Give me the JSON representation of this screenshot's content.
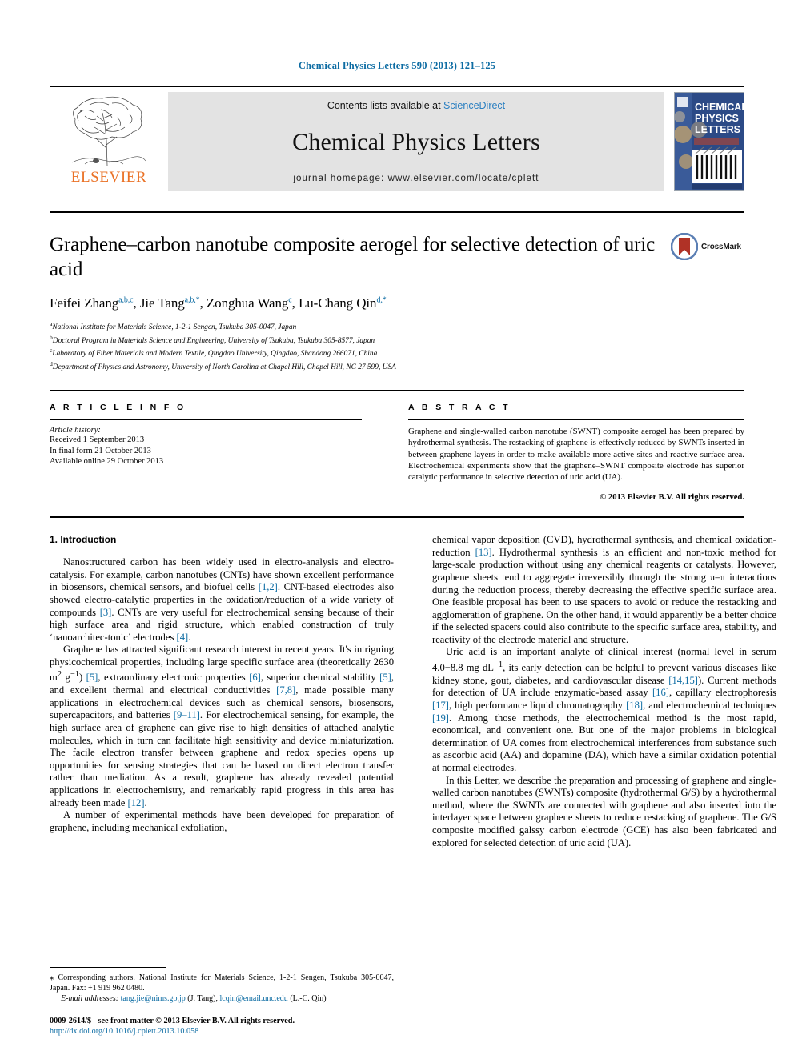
{
  "running_head": "Chemical Physics Letters 590 (2013) 121–125",
  "masthead": {
    "publisher_name": "ELSEVIER",
    "contents_prefix": "Contents lists available at ",
    "contents_link": "ScienceDirect",
    "journal_title": "Chemical Physics Letters",
    "homepage_line": "journal homepage: www.elsevier.com/locate/cplett",
    "cover": {
      "line1": "CHEMICAL",
      "line2": "PHYSICS",
      "line3": "LETTERS",
      "background": "#2c4a86",
      "title_color": "#ffffff"
    }
  },
  "article": {
    "title": "Graphene–carbon nanotube composite aerogel for selective detection of uric acid",
    "authors": [
      {
        "name": "Feifei Zhang",
        "sup": "a,b,c",
        "sep": ", "
      },
      {
        "name": "Jie Tang",
        "sup": "a,b,*",
        "sep": ", "
      },
      {
        "name": "Zonghua Wang",
        "sup": "c",
        "sep": ", "
      },
      {
        "name": "Lu-Chang Qin",
        "sup": "d,*",
        "sep": ""
      }
    ],
    "affiliations": [
      {
        "mark": "a",
        "text": "National Institute for Materials Science, 1-2-1 Sengen, Tsukuba 305-0047, Japan"
      },
      {
        "mark": "b",
        "text": "Doctoral Program in Materials Science and Engineering, University of Tsukuba, Tsukuba 305-8577, Japan"
      },
      {
        "mark": "c",
        "text": "Laboratory of Fiber Materials and Modern Textile, Qingdao University, Qingdao, Shandong 266071, China"
      },
      {
        "mark": "d",
        "text": "Department of Physics and Astronomy, University of North Carolina at Chapel Hill, Chapel Hill, NC 27 599, USA"
      }
    ],
    "crossmark_label": "CrossMark"
  },
  "info": {
    "heading": "A R T I C L E    I N F O",
    "history_label": "Article history:",
    "history": [
      "Received 1 September 2013",
      "In final form 21 October 2013",
      "Available online 29 October 2013"
    ]
  },
  "abstract": {
    "heading": "A B S T R A C T",
    "text": "Graphene and single-walled carbon nanotube (SWNT) composite aerogel has been prepared by hydrothermal synthesis. The restacking of graphene is effectively reduced by SWNTs inserted in between graphene layers in order to make available more active sites and reactive surface area. Electrochemical experiments show that the graphene–SWNT composite electrode has superior catalytic performance in selective detection of uric acid (UA).",
    "copyright": "© 2013 Elsevier B.V. All rights reserved."
  },
  "body": {
    "section_title": "1. Introduction",
    "left_paragraphs": [
      {
        "parts": [
          {
            "t": "Nanostructured carbon has been widely used in electro-analysis and electro-catalysis. For example, carbon nanotubes (CNTs) have shown excellent performance in biosensors, chemical sensors, and biofuel cells "
          },
          {
            "t": "[1,2]",
            "ref": true
          },
          {
            "t": ". CNT-based electrodes also showed electro-catalytic properties in the oxidation/reduction of a wide variety of compounds "
          },
          {
            "t": "[3]",
            "ref": true
          },
          {
            "t": ". CNTs are very useful for electrochemical sensing because of their high surface area and rigid structure, which enabled construction of truly ‘nanoarchitec-tonic’ electrodes "
          },
          {
            "t": "[4]",
            "ref": true
          },
          {
            "t": "."
          }
        ]
      },
      {
        "parts": [
          {
            "t": "Graphene has attracted significant research interest in recent years. It's intriguing physicochemical properties, including large specific surface area (theoretically 2630 m"
          },
          {
            "t": "2",
            "sup": true
          },
          {
            "t": " g"
          },
          {
            "t": "−1",
            "sup": true
          },
          {
            "t": ") "
          },
          {
            "t": "[5]",
            "ref": true
          },
          {
            "t": ", extraordinary electronic properties "
          },
          {
            "t": "[6]",
            "ref": true
          },
          {
            "t": ", superior chemical stability "
          },
          {
            "t": "[5]",
            "ref": true
          },
          {
            "t": ", and excellent thermal and electrical conductivities "
          },
          {
            "t": "[7,8]",
            "ref": true
          },
          {
            "t": ", made possible many applications in electrochemical devices such as chemical sensors, biosensors, supercapacitors, and batteries "
          },
          {
            "t": "[9–11]",
            "ref": true
          },
          {
            "t": ". For electrochemical sensing, for example, the high surface area of graphene can give rise to high densities of attached analytic molecules, which in turn can facilitate high sensitivity and device miniaturization. The facile electron transfer between graphene and redox species opens up opportunities for sensing strategies that can be based on direct electron transfer rather than mediation. As a result, graphene has already revealed potential applications in electrochemistry, and remarkably rapid progress in this area has already been made "
          },
          {
            "t": "[12]",
            "ref": true
          },
          {
            "t": "."
          }
        ]
      },
      {
        "parts": [
          {
            "t": "A number of experimental methods have been developed for preparation of graphene, including mechanical exfoliation,"
          }
        ]
      }
    ],
    "right_paragraphs": [
      {
        "no_indent": true,
        "parts": [
          {
            "t": "chemical vapor deposition (CVD), hydrothermal synthesis, and chemical oxidation-reduction "
          },
          {
            "t": "[13]",
            "ref": true
          },
          {
            "t": ". Hydrothermal synthesis is an efficient and non-toxic method for large-scale production without using any chemical reagents or catalysts. However, graphene sheets tend to aggregate irreversibly through the strong π–π interactions during the reduction process, thereby decreasing the effective specific surface area. One feasible proposal has been to use spacers to avoid or reduce the restacking and agglomeration of graphene. On the other hand, it would apparently be a better choice if the selected spacers could also contribute to the specific surface area, stability, and reactivity of the electrode material and structure."
          }
        ]
      },
      {
        "parts": [
          {
            "t": "Uric acid is an important analyte of clinical interest (normal level in serum 4.0−8.8 mg dL"
          },
          {
            "t": "−1",
            "sup": true
          },
          {
            "t": ", its early detection can be helpful to prevent various diseases like kidney stone, gout, diabetes, and cardiovascular disease "
          },
          {
            "t": "[14,15]",
            "ref": true
          },
          {
            "t": "). Current methods for detection of UA include enzymatic-based assay "
          },
          {
            "t": "[16]",
            "ref": true
          },
          {
            "t": ", capillary electrophoresis "
          },
          {
            "t": "[17]",
            "ref": true
          },
          {
            "t": ", high performance liquid chromatography "
          },
          {
            "t": "[18]",
            "ref": true
          },
          {
            "t": ", and electrochemical techniques "
          },
          {
            "t": "[19]",
            "ref": true
          },
          {
            "t": ". Among those methods, the electrochemical method is the most rapid, economical, and convenient one. But one of the major problems in biological determination of UA comes from electrochemical interferences from substance such as ascorbic acid (AA) and dopamine (DA), which have a similar oxidation potential at normal electrodes."
          }
        ]
      },
      {
        "parts": [
          {
            "t": "In this Letter, we describe the preparation and processing of graphene and single-walled carbon nanotubes (SWNTs) composite (hydrothermal G/S) by a hydrothermal method, where the SWNTs are connected with graphene and also inserted into the interlayer space between graphene sheets to reduce restacking of graphene. The G/S composite modified galssy carbon electrode (GCE) has also been fabricated and explored for selected detection of uric acid (UA)."
          }
        ]
      }
    ]
  },
  "footnotes": {
    "corresponding_star": "⁎",
    "corresponding_text": "Corresponding authors. National Institute for Materials Science, 1-2-1 Sengen, Tsukuba 305-0047, Japan. Fax: +1 919 962 0480.",
    "email_label": "E-mail addresses:",
    "emails": [
      {
        "address": "tang.jie@nims.go.jp",
        "owner": "(J. Tang)"
      },
      {
        "address": "lcqin@email.unc.edu",
        "owner": "(L.-C. Qin)"
      }
    ],
    "issn_line": "0009-2614/$ - see front matter © 2013 Elsevier B.V. All rights reserved.",
    "doi": "http://dx.doi.org/10.1016/j.cplett.2013.10.058"
  },
  "colors": {
    "link": "#0d6ca3",
    "elsevier_orange": "#ea7125",
    "masthead_grey": "#e3e3e3",
    "cover_blue": "#2c4a86"
  }
}
